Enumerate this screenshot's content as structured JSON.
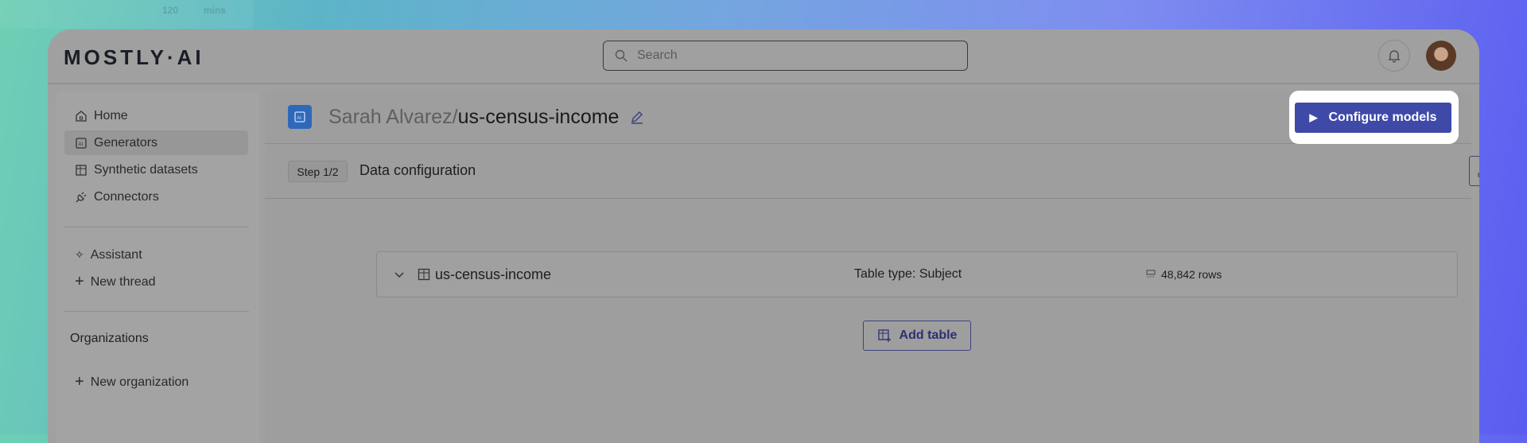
{
  "background": {
    "fragment_value": "120",
    "fragment_unit": "mins"
  },
  "header": {
    "logo": "MOSTLY·AI",
    "search_placeholder": "Search"
  },
  "sidebar": {
    "items": [
      {
        "label": "Home",
        "icon": "home-icon"
      },
      {
        "label": "Generators",
        "icon": "ai-chip-icon",
        "active": true
      },
      {
        "label": "Synthetic datasets",
        "icon": "table-sparkle-icon"
      },
      {
        "label": "Connectors",
        "icon": "plug-icon"
      }
    ],
    "assistant": {
      "label": "Assistant",
      "new_thread": "New thread"
    },
    "organizations": {
      "heading": "Organizations",
      "new_org": "New organization"
    }
  },
  "main": {
    "owner": "Sarah Alvarez/",
    "generator_name": "us-census-income",
    "configure_label": "Configure models",
    "step_badge": "Step 1/2",
    "step_title": "Data configuration",
    "tables": [
      {
        "name": "us-census-income",
        "type": "Table type: Subject",
        "rows": "48,842 rows"
      }
    ],
    "add_table_label": "Add table"
  },
  "colors": {
    "primary": "#3f4aa8",
    "ai_icon": "#2f68b8"
  }
}
